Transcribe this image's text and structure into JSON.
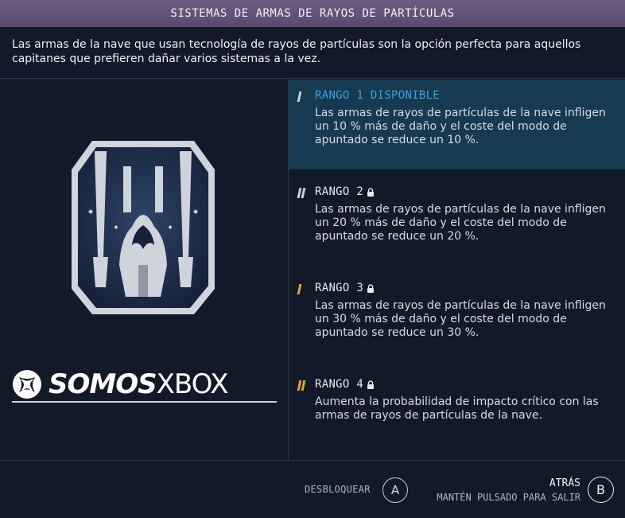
{
  "header": {
    "title": "SISTEMAS DE ARMAS DE RAYOS DE PARTÍCULAS"
  },
  "intro": "Las armas de la nave que usan tecnología de rayos de partículas son la opción perfecta para aquellos capitanes que prefieren dañar varios sistemas a la vez.",
  "logo": {
    "brand_bold": "SOMOS",
    "brand_light": "XBOX"
  },
  "ranks": [
    {
      "label": "RANGO 1 DISPONIBLE",
      "desc": "Las armas de rayos de partículas de la nave infligen un 10 % más de daño y el coste del modo de apuntado se reduce un 10 %.",
      "bar_color": "#c9ced6",
      "locked": false
    },
    {
      "label": "RANGO 2",
      "desc": "Las armas de rayos de partículas de la nave infligen un 20 % más de daño y el coste del modo de apuntado se reduce un 20 %.",
      "bar_color": "#c9ced6",
      "locked": true
    },
    {
      "label": "RANGO 3",
      "desc": "Las armas de rayos de partículas de la nave infligen un 30 % más de daño y el coste del modo de apuntado se reduce un 30 %.",
      "bar_color": "#e8a23a",
      "locked": true
    },
    {
      "label": "RANGO 4",
      "desc": "Aumenta la probabilidad de impacto crítico con las armas de rayos de partículas de la nave.",
      "bar_color": "#e8a23a",
      "locked": true
    }
  ],
  "footer": {
    "unlock_label": "DESBLOQUEAR",
    "unlock_key": "A",
    "back_label": "ATRÁS",
    "back_hint": "MANTÉN PULSADO PARA SALIR",
    "back_key": "B"
  },
  "colors": {
    "accent": "#3aa0e0",
    "active_bg": "#153a52",
    "header_bg": "#5c4a6e",
    "gold": "#e8a23a"
  }
}
